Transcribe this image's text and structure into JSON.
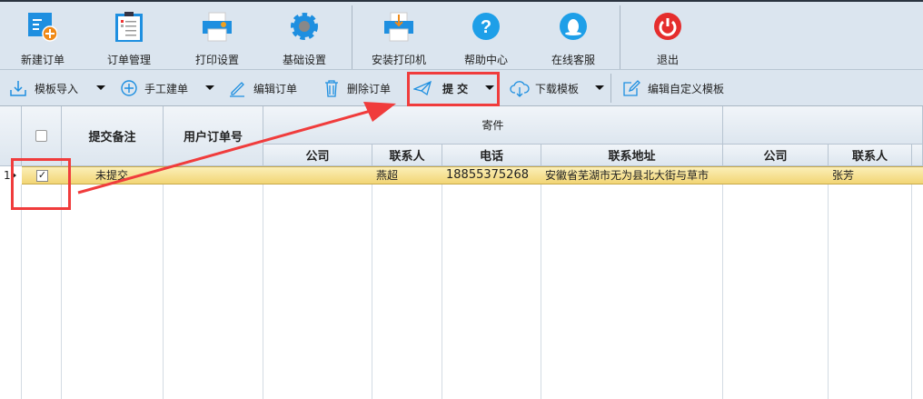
{
  "main_toolbar": [
    {
      "label": "新建订单",
      "icon": "new-order-icon"
    },
    {
      "label": "订单管理",
      "icon": "clipboard-icon"
    },
    {
      "label": "打印设置",
      "icon": "printer-settings-icon"
    },
    {
      "label": "基础设置",
      "icon": "gear-icon"
    },
    {
      "label": "安装打印机",
      "icon": "install-printer-icon"
    },
    {
      "label": "帮助中心",
      "icon": "help-icon"
    },
    {
      "label": "在线客服",
      "icon": "chat-icon"
    },
    {
      "label": "退出",
      "icon": "power-icon"
    }
  ],
  "action_toolbar": {
    "import": "模板导入",
    "manual": "手工建单",
    "edit": "编辑订单",
    "delete": "删除订单",
    "submit": "提 交",
    "download": "下载模板",
    "edit_template": "编辑自定义模板"
  },
  "grid": {
    "headers": {
      "remark": "提交备注",
      "user_order": "用户订单号",
      "sender_group": "寄件",
      "company": "公司",
      "contact": "联系人",
      "phone": "电话",
      "address": "联系地址",
      "company2": "公司",
      "contact2": "联系人"
    },
    "rows": [
      {
        "num": "1",
        "checked": true,
        "remark": "未提交",
        "user_order": "",
        "company": "",
        "contact": "燕超",
        "phone": "18855375268",
        "address": "安徽省芜湖市无为县北大街与草市",
        "company2": "",
        "contact2": "张芳"
      }
    ]
  },
  "colors": {
    "annotation": "#f03c3c",
    "selected_row": "#f5dc84"
  }
}
